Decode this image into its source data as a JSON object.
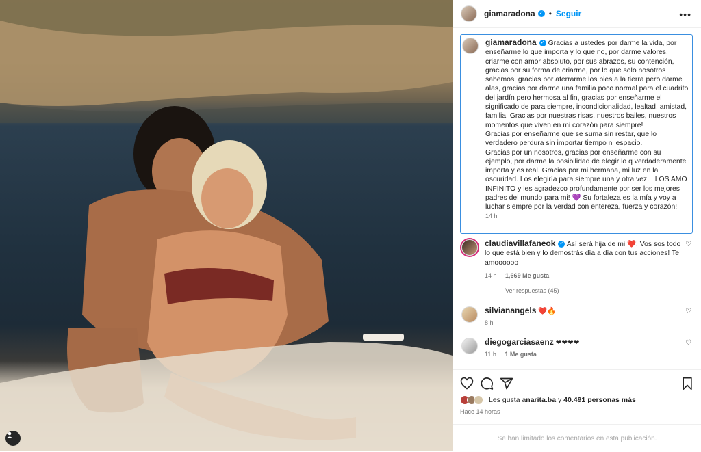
{
  "post": {
    "username": "giamaradona",
    "follow_label": "Seguir",
    "separator": "•"
  },
  "caption": {
    "username": "giamaradona",
    "text": "Gracias a ustedes por darme la vida, por enseñarme lo que importa y lo que no, por darme valores, criarme con amor absoluto, por sus abrazos, su contención, gracias por su forma de criarme, por lo que solo nosotros sabemos, gracias por aferrarme los pies a la tierra pero darme alas, gracias por darme una familia poco normal para el cuadrito del jardín pero hermosa al fin, gracias por enseñarme el significado de para siempre, incondicionalidad, lealtad, amistad, familia. Gracias por nuestras risas, nuestros bailes, nuestros momentos que viven en mi corazón para siempre!\nGracias por enseñarme que se suma sin restar, que lo verdadero perdura sin importar tiempo ni espacio.\nGracias por un nosotros, gracias por enseñarme con su ejemplo, por darme la posibilidad de elegir lo q verdaderamente importa y es real. Gracias por mi hermana, mi luz en la oscuridad. Los elegiría para siempre una y otra vez... LOS AMO INFINITO y les agradezco profundamente por ser los mejores padres del mundo para mi! 💜 Su fortaleza es la mía y voy a luchar siempre por la verdad con entereza, fuerza y corazón!",
    "time": "14 h"
  },
  "comments": [
    {
      "username": "claudiavillafaneok",
      "text": "Así será hija de mi ❤️! Vos sos todo lo que está bien y lo demostrás día a día con tus acciones! Te amoooooo",
      "time": "14 h",
      "likes": "1,669 Me gusta"
    },
    {
      "username": "silvianangels",
      "text": "❤️🔥",
      "time": "8 h",
      "likes": ""
    },
    {
      "username": "diegogarciasaenz",
      "text": "❤❤❤❤",
      "time": "11 h",
      "likes": "1 Me gusta"
    }
  ],
  "replies_label": "Ver respuestas (45)",
  "likes": {
    "prefix": "Les gusta a ",
    "user": "narita.ba",
    "middle": " y ",
    "count": "40.491 personas más"
  },
  "posted_ago": "Hace 14 horas",
  "comments_limited": "Se han limitado los comentarios en esta publicación.",
  "icons": {
    "more": "more-icon",
    "like": "heart-icon",
    "comment": "comment-icon",
    "share": "share-icon",
    "save": "bookmark-icon",
    "tagged_user": "user-tag-icon"
  },
  "colors": {
    "accent": "#0095f6",
    "focus_border": "#3a8fe0",
    "muted": "#737373"
  }
}
